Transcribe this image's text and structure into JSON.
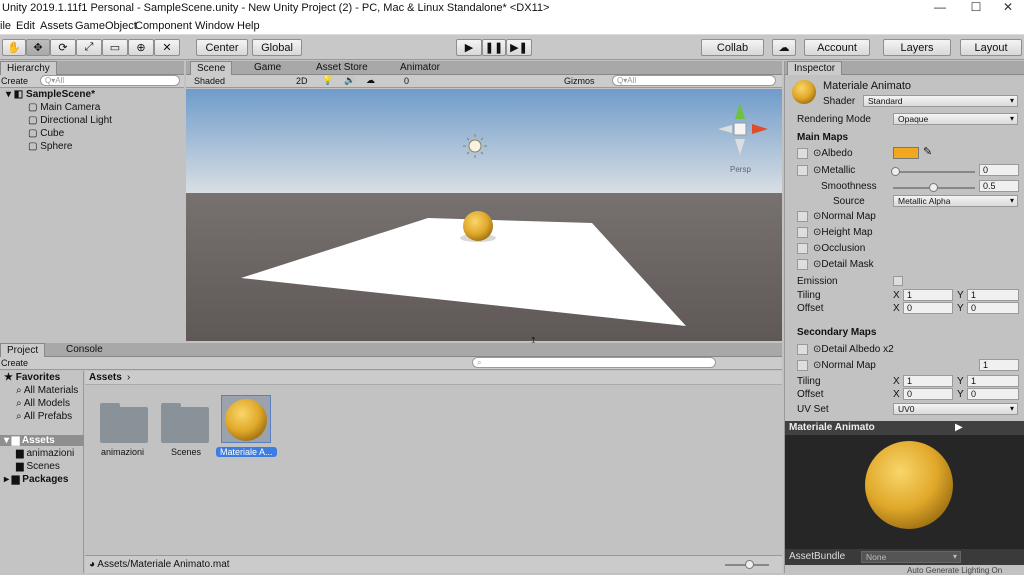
{
  "title": "Unity 2019.1.11f1 Personal - SampleScene.unity - New Unity Project (2) - PC, Mac & Linux Standalone* <DX11>",
  "window_controls": [
    "—",
    "☐",
    "✕"
  ],
  "menu": [
    "ile",
    "Edit",
    "Assets",
    "GameObject",
    "Component",
    "Window",
    "Help"
  ],
  "toolbar": {
    "tools": [
      "✋",
      "✥",
      "⟳",
      "⤢",
      "▭",
      "⊕",
      "✕"
    ],
    "center": "Center",
    "global": "Global",
    "play": "▶",
    "pause": "❚❚",
    "step": "▶❚",
    "collab": "Collab",
    "cloud": "☁",
    "account": "Account",
    "layers": "Layers",
    "layout": "Layout"
  },
  "hierarchy": {
    "tab": "Hierarchy",
    "create": "Create",
    "search": "Q▾All",
    "scene": "SampleScene*",
    "items": [
      "Main Camera",
      "Directional Light",
      "Cube",
      "Sphere"
    ]
  },
  "scene": {
    "tabs": [
      "Scene",
      "Game",
      "Asset Store",
      "Animator"
    ],
    "shaded": "Shaded",
    "mode2d": "2D",
    "light": "💡",
    "audio": "🔊",
    "fx": "☁",
    "hidden": "0",
    "gizmos": "Gizmos",
    "search": "Q▾All",
    "persp": "Persp"
  },
  "project": {
    "tabs": [
      "Project",
      "Console"
    ],
    "create": "Create",
    "favorites": "Favorites",
    "fav_items": [
      "All Materials",
      "All Models",
      "All Prefabs"
    ],
    "assets": "Assets",
    "asset_folders": [
      "animazioni",
      "Scenes"
    ],
    "packages": "Packages",
    "breadcrumb": "Assets",
    "grid_items": [
      "animazioni",
      "Scenes",
      "Materiale A..."
    ],
    "path": "Assets/Materiale Animato.mat"
  },
  "inspector": {
    "tab": "Inspector",
    "name": "Materiale Animato",
    "shader_label": "Shader",
    "shader": "Standard",
    "rendering_mode_label": "Rendering Mode",
    "rendering_mode": "Opaque",
    "main_maps": "Main Maps",
    "albedo": "Albedo",
    "metallic": "Metallic",
    "metallic_value": "0",
    "smoothness": "Smoothness",
    "smoothness_value": "0.5",
    "source_label": "Source",
    "source": "Metallic Alpha",
    "normal_map": "Normal Map",
    "height_map": "Height Map",
    "occlusion": "Occlusion",
    "detail_mask": "Detail Mask",
    "emission": "Emission",
    "tiling": "Tiling",
    "offset": "Offset",
    "x": "X",
    "y": "Y",
    "tiling_x": "1",
    "tiling_y": "1",
    "offset_x": "0",
    "offset_y": "0",
    "secondary_maps": "Secondary Maps",
    "detail_albedo": "Detail Albedo x2",
    "sec_normal": "Normal Map",
    "sec_normal_value": "1",
    "tiling2_x": "1",
    "tiling2_y": "1",
    "offset2_x": "0",
    "offset2_y": "0",
    "uv_set_label": "UV Set",
    "uv_set": "UV0",
    "preview_title": "Materiale Animato",
    "assetbundle": "AssetBundle",
    "assetbundle_value": "None",
    "status": "Auto Generate Lighting On"
  },
  "colors": {
    "albedo": "#f2a81e",
    "sky_top": "#6d9bc8",
    "ground": "#6b6361",
    "accent": "#3d7ce0"
  }
}
